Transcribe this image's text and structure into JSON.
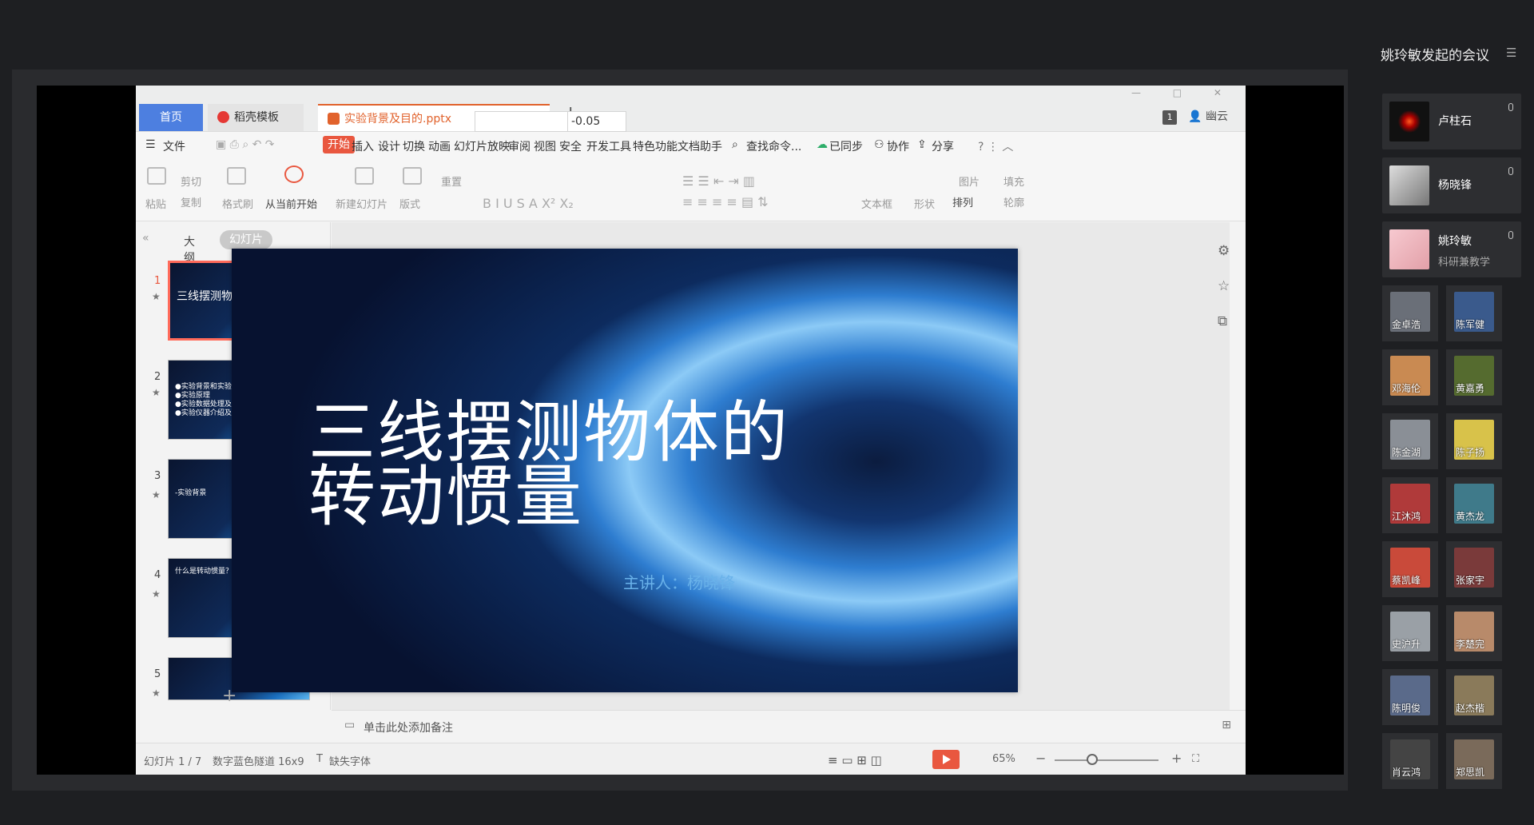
{
  "meeting": {
    "title": "姚玲敏发起的会议",
    "main_participants": [
      {
        "name": "卢柱石",
        "role": ""
      },
      {
        "name": "杨晓锋",
        "role": ""
      },
      {
        "name": "姚玲敏",
        "role": "科研兼教学"
      }
    ],
    "tiles": [
      "金卓浩",
      "陈军健",
      "邓海伦",
      "黄嘉勇",
      "陈金湖",
      "陈子扬",
      "江沐鸿",
      "黄杰龙",
      "蔡凯峰",
      "张家宇",
      "史沪升",
      "李楚完",
      "陈明俊",
      "赵杰楷",
      "肖云鸿",
      "郑思凯"
    ]
  },
  "wps": {
    "tabs": {
      "home": "首页",
      "template": "稻壳模板",
      "file": "实验背景及目的.pptx"
    },
    "header_right": {
      "badge": "1",
      "user": "幽云"
    },
    "menu": [
      "文件",
      "开始",
      "插入",
      "设计",
      "切换",
      "动画",
      "幻灯片放映",
      "审阅",
      "视图",
      "安全",
      "开发工具",
      "特色功能",
      "文档助手"
    ],
    "menu_search": "查找命令...",
    "menu_right": [
      "已同步",
      "协作",
      "分享"
    ],
    "ribbon": {
      "paste": "粘贴",
      "cut": "剪切",
      "copy": "复制",
      "format_painter": "格式刷",
      "from_current": "从当前开始",
      "new_slide": "新建幻灯片",
      "layout": "版式",
      "reset": "重置",
      "font_size": "-0.05",
      "textbox": "文本框",
      "shape": "形状",
      "arrange": "排列",
      "picture": "图片",
      "fill": "填充",
      "outline": "轮廓"
    },
    "panel_tabs": {
      "outline": "大纲",
      "slides": "幻灯片"
    },
    "slides": [
      {
        "num": "1",
        "text": "三线摆测物体的转动惯量"
      },
      {
        "num": "2",
        "text": "●实验背景和实验目的\n●实验原理\n●实验数据处理及分析\n●实验仪器介绍及演示"
      },
      {
        "num": "3",
        "text": "-实验背景"
      },
      {
        "num": "4",
        "text": "什么是转动惯量？"
      },
      {
        "num": "5",
        "text": ""
      }
    ],
    "current_slide": {
      "title": "三线摆测物体的\n转动惯量",
      "subtitle": "主讲人：杨晓锋"
    },
    "notes_placeholder": "单击此处添加备注",
    "status": {
      "slide_pos": "幻灯片 1 / 7",
      "theme": "数字蓝色隧道 16x9",
      "missing_font": "缺失字体",
      "zoom": "65%"
    }
  }
}
